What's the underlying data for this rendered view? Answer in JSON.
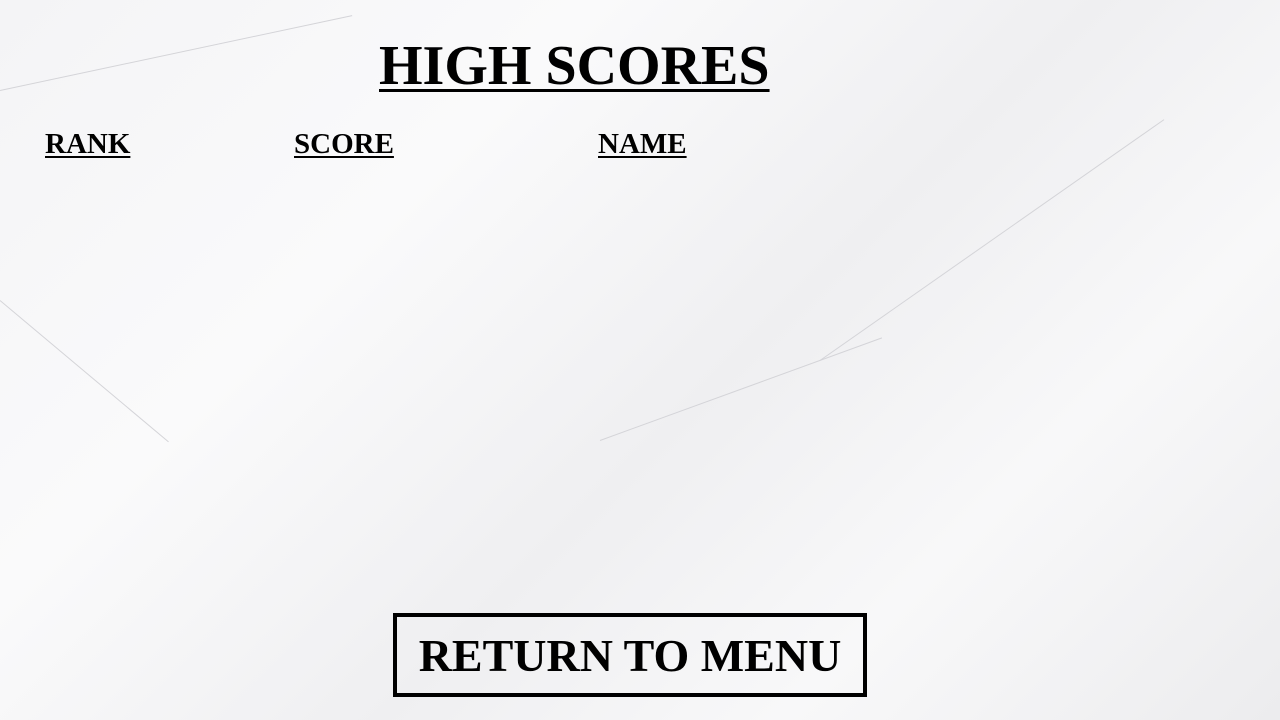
{
  "title": "HIGH SCORES",
  "columns": {
    "rank": "RANK",
    "score": "SCORE",
    "name": "NAME"
  },
  "rows": [],
  "return_button": "RETURN TO MENU"
}
